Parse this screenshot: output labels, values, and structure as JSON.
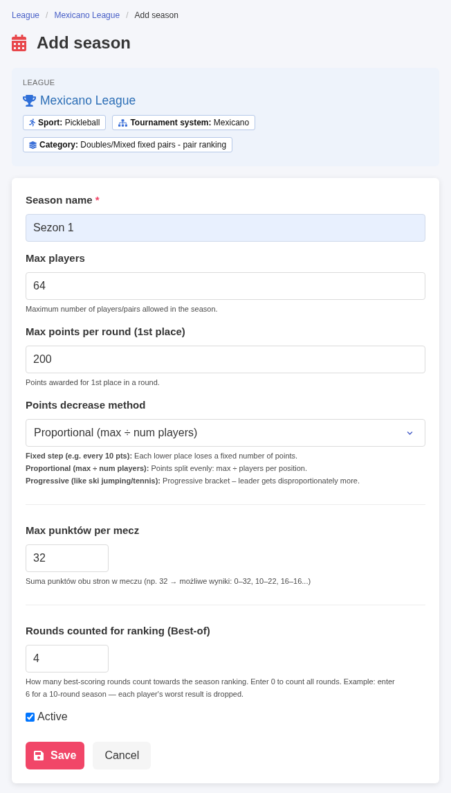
{
  "breadcrumb": [
    {
      "label": "League",
      "current": false
    },
    {
      "separator": "/",
      "label": "Mexicano League",
      "current": false
    },
    {
      "separator": "/",
      "label": "Add season",
      "current": true
    }
  ],
  "page": {
    "title": "Add season"
  },
  "league": {
    "caption": "LEAGUE",
    "name": "Mexicano League",
    "tags": [
      {
        "kind": "sport",
        "label": "Sport:",
        "value": "Pickleball"
      },
      {
        "kind": "system",
        "label": "Tournament system:",
        "value": "Mexicano"
      },
      {
        "kind": "category",
        "label": "Category:",
        "value": "Doubles/Mixed fixed pairs - pair ranking"
      }
    ]
  },
  "form": {
    "sections": [
      {
        "fields": [
          {
            "kind": "text",
            "label": "Season name",
            "required_mark": "*",
            "value": "Sezon 1",
            "autofilled": true
          },
          {
            "kind": "number",
            "label": "Max players",
            "value": "64",
            "autofilled": false,
            "help": [
              "Maximum number of players/pairs allowed in the season."
            ]
          },
          {
            "kind": "number",
            "label": "Max points per round (1st place)",
            "value": "200",
            "autofilled": false,
            "help": [
              "Points awarded for 1st place in a round."
            ]
          },
          {
            "kind": "select",
            "label": "Points decrease method",
            "value": "Proportional (max ÷ num players)",
            "help": [
              "**Fixed step (e.g. every 10 pts):** Each lower place loses a fixed number of points.",
              "**Proportional (max ÷ num players):** Points split evenly: max ÷ players per position.",
              "**Progressive (like ski jumping/tennis):** Progressive bracket – leader gets disproportionately more."
            ]
          }
        ]
      },
      {
        "fields": [
          {
            "kind": "short_number",
            "label": "Max punktów per mecz",
            "value": "32",
            "autofilled": false,
            "help": [
              "Suma punktów obu stron w meczu (np. 32 → możliwe wyniki: 0–32, 10–22, 16–16...)"
            ]
          }
        ]
      },
      {
        "fields": [
          {
            "kind": "short_number",
            "label": "Rounds counted for ranking (Best-of)",
            "value": "4",
            "autofilled": false,
            "help": [
              "How many best-scoring rounds count towards the season ranking. Enter 0 to count all rounds. Example: enter 6 for a 10-round season — each player's worst result is dropped."
            ]
          }
        ]
      }
    ],
    "checkbox": {
      "label": "Active",
      "checked": true
    },
    "buttons": [
      {
        "kind": "primary",
        "label": "Save"
      },
      {
        "kind": "secondary",
        "label": "Cancel"
      }
    ]
  }
}
